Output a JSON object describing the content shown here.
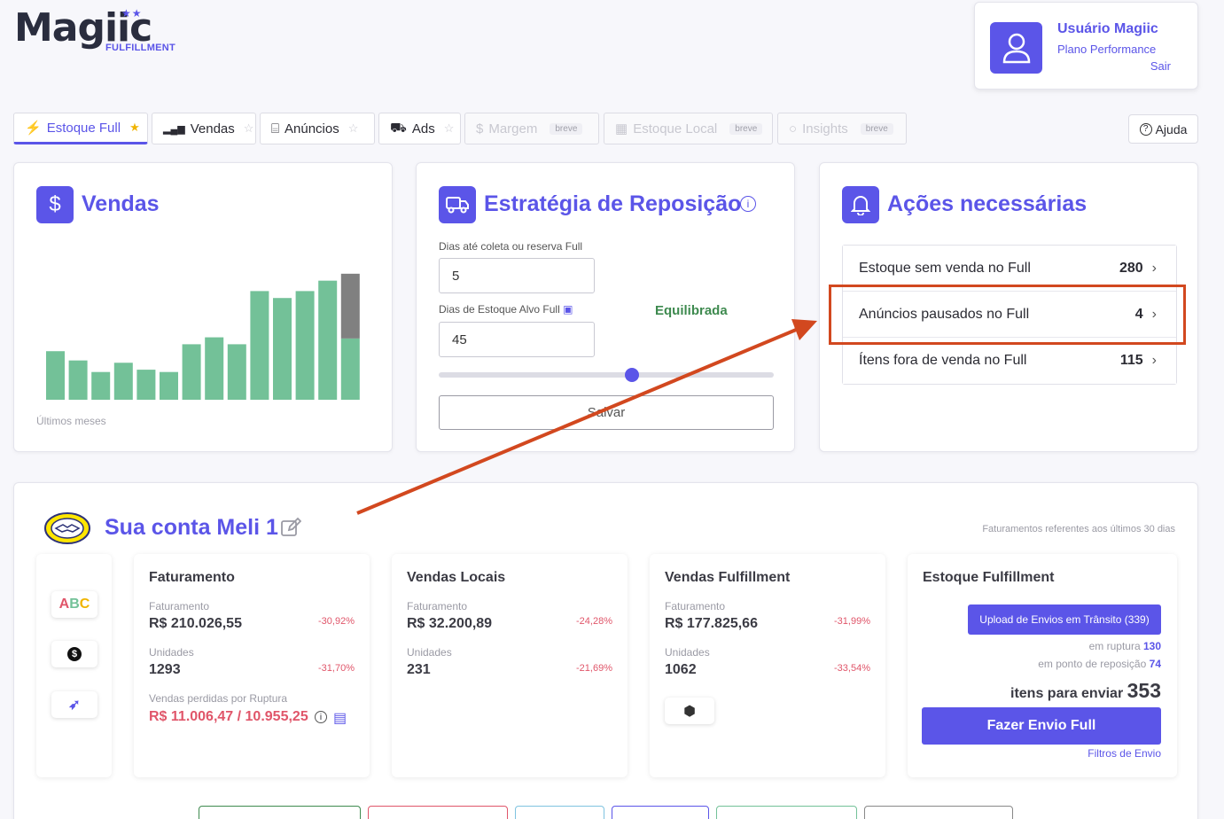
{
  "brand": {
    "name": "Magiic",
    "sub": "FULFILLMENT",
    "stars": "★★"
  },
  "user": {
    "name": "Usuário Magiic",
    "plan": "Plano Performance",
    "logout": "Sair"
  },
  "tabs": [
    {
      "label": "Estoque Full",
      "icon": "bolt-icon",
      "glyph": "⚡",
      "star": "★",
      "soon": ""
    },
    {
      "label": "Vendas",
      "icon": "bar-chart-icon",
      "glyph": "▮",
      "star": "☆",
      "soon": ""
    },
    {
      "label": "Anúncios",
      "icon": "gift-icon",
      "glyph": "🎁",
      "star": "☆",
      "soon": ""
    },
    {
      "label": "Ads",
      "icon": "cart-icon",
      "glyph": "🛒",
      "star": "☆",
      "soon": ""
    },
    {
      "label": "Margem",
      "icon": "dollar-icon",
      "glyph": "$",
      "star": "",
      "soon": "breve"
    },
    {
      "label": "Estoque Local",
      "icon": "building-icon",
      "glyph": "▦",
      "star": "",
      "soon": "breve"
    },
    {
      "label": "Insights",
      "icon": "lightbulb-icon",
      "glyph": "💡",
      "star": "",
      "soon": "breve"
    }
  ],
  "help": {
    "label": "Ajuda"
  },
  "sales_card": {
    "title": "Vendas",
    "caption": "Últimos meses"
  },
  "chart_data": {
    "type": "bar",
    "title": "",
    "xlabel": "Últimos meses",
    "ylabel": "",
    "series": [
      {
        "values": [
          42,
          34,
          24,
          32,
          26,
          24,
          48,
          54,
          48,
          94,
          88,
          94,
          103,
          53
        ]
      },
      {
        "values": [
          0,
          0,
          0,
          0,
          0,
          0,
          0,
          0,
          0,
          0,
          0,
          0,
          0,
          56
        ]
      }
    ],
    "colors": [
      "#73c198",
      "#808080"
    ],
    "grid": false
  },
  "strategy": {
    "title": "Estratégia de Reposição",
    "label_days_collect": "Dias até coleta ou reserva Full",
    "value_days_collect": "5",
    "label_days_target": "Dias de Estoque Alvo Full",
    "value_days_target": "45",
    "status": "Equilibrada",
    "slider_level": 0.58,
    "save": "Salvar"
  },
  "actions": {
    "title": "Ações necessárias",
    "items": [
      {
        "label": "Estoque sem venda no Full",
        "count": "280"
      },
      {
        "label": "Anúncios pausados no Full",
        "count": "4"
      },
      {
        "label": "Ítens fora de venda no Full",
        "count": "115"
      }
    ]
  },
  "account": {
    "title": "Sua conta Meli 1",
    "note": "Faturamentos referentes aos últimos 30 dias",
    "side_buttons": [
      "ABC",
      "$",
      "🚀"
    ],
    "faturamento": {
      "title": "Faturamento",
      "rev_label": "Faturamento",
      "rev_value": "R$ 210.026,55",
      "rev_pct": "-30,92%",
      "units_label": "Unidades",
      "units_value": "1293",
      "units_pct": "-31,70%",
      "lost_label": "Vendas perdidas por Ruptura",
      "lost_value": "R$ 11.006,47 / 10.955,25"
    },
    "local": {
      "title": "Vendas Locais",
      "rev_label": "Faturamento",
      "rev_value": "R$ 32.200,89",
      "rev_pct": "-24,28%",
      "units_label": "Unidades",
      "units_value": "231",
      "units_pct": "-21,69%"
    },
    "fulfillment": {
      "title": "Vendas Fulfillment",
      "rev_label": "Faturamento",
      "rev_value": "R$ 177.825,66",
      "rev_pct": "-31,99%",
      "units_label": "Unidades",
      "units_value": "1062",
      "units_pct": "-33,54%"
    },
    "stock": {
      "title": "Estoque Fulfillment",
      "upload": "Upload de Envios em Trânsito (339)",
      "rupture_label": "em ruptura",
      "rupture_value": "130",
      "reorder_label": "em ponto de reposição",
      "reorder_value": "74",
      "to_send_label": "itens para enviar",
      "to_send_value": "353",
      "send_button": "Fazer Envio Full",
      "filters": "Filtros de Envio"
    }
  }
}
